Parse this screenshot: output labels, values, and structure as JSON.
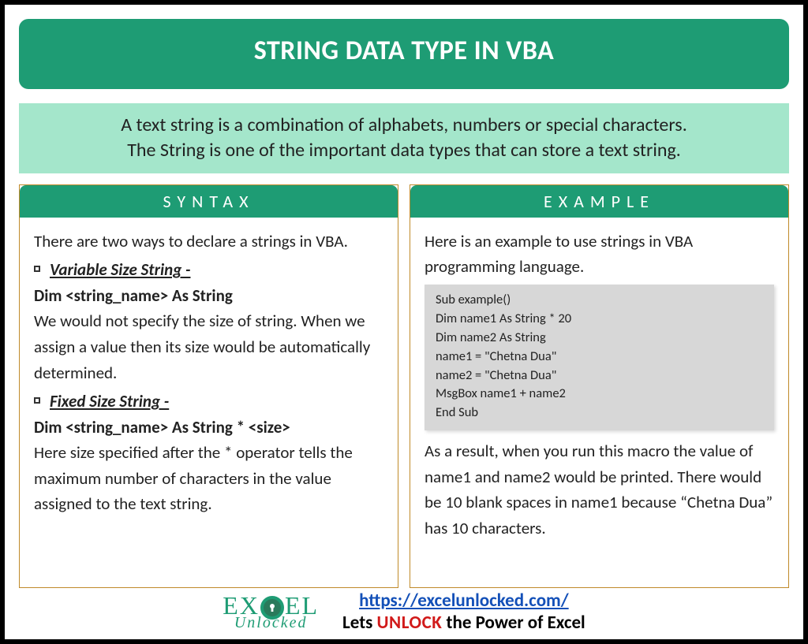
{
  "title": "STRING DATA TYPE IN VBA",
  "intro_line1": "A text string is a combination of alphabets, numbers or special characters.",
  "intro_line2": "The String is one of the important data types that can store a text string.",
  "syntax": {
    "header": "SYNTAX",
    "intro": "There are two ways to declare a strings in VBA.",
    "var_title": "Variable Size String -",
    "var_decl": "Dim <string_name> As String",
    "var_desc": "We would not specify the size of string. When we assign a value then its size would be automatically determined.",
    "fix_title": "Fixed Size String -",
    "fix_decl": "Dim <string_name> As String * <size>",
    "fix_desc": "Here size specified after the * operator tells the maximum number of characters in the value assigned to the text string."
  },
  "example": {
    "header": "EXAMPLE",
    "intro": "Here is an example to use strings in VBA programming language.",
    "code": "Sub example()\nDim name1 As String * 20\nDim name2 As String\nname1 = \"Chetna Dua\"\nname2 = \"Chetna Dua\"\nMsgBox name1 + name2\nEnd Sub",
    "result": "As a result, when you run this macro the value of name1 and name2 would be printed. There would be 10 blank spaces in name1 because “Chetna Dua” has 10 characters."
  },
  "footer": {
    "logo_top_left": "EX",
    "logo_top_right": "EL",
    "logo_bottom": "Unlocked",
    "url": "https://excelunlocked.com/",
    "tag_pre": "Lets ",
    "tag_unlock": "UNLOCK",
    "tag_post": " the Power of Excel"
  }
}
